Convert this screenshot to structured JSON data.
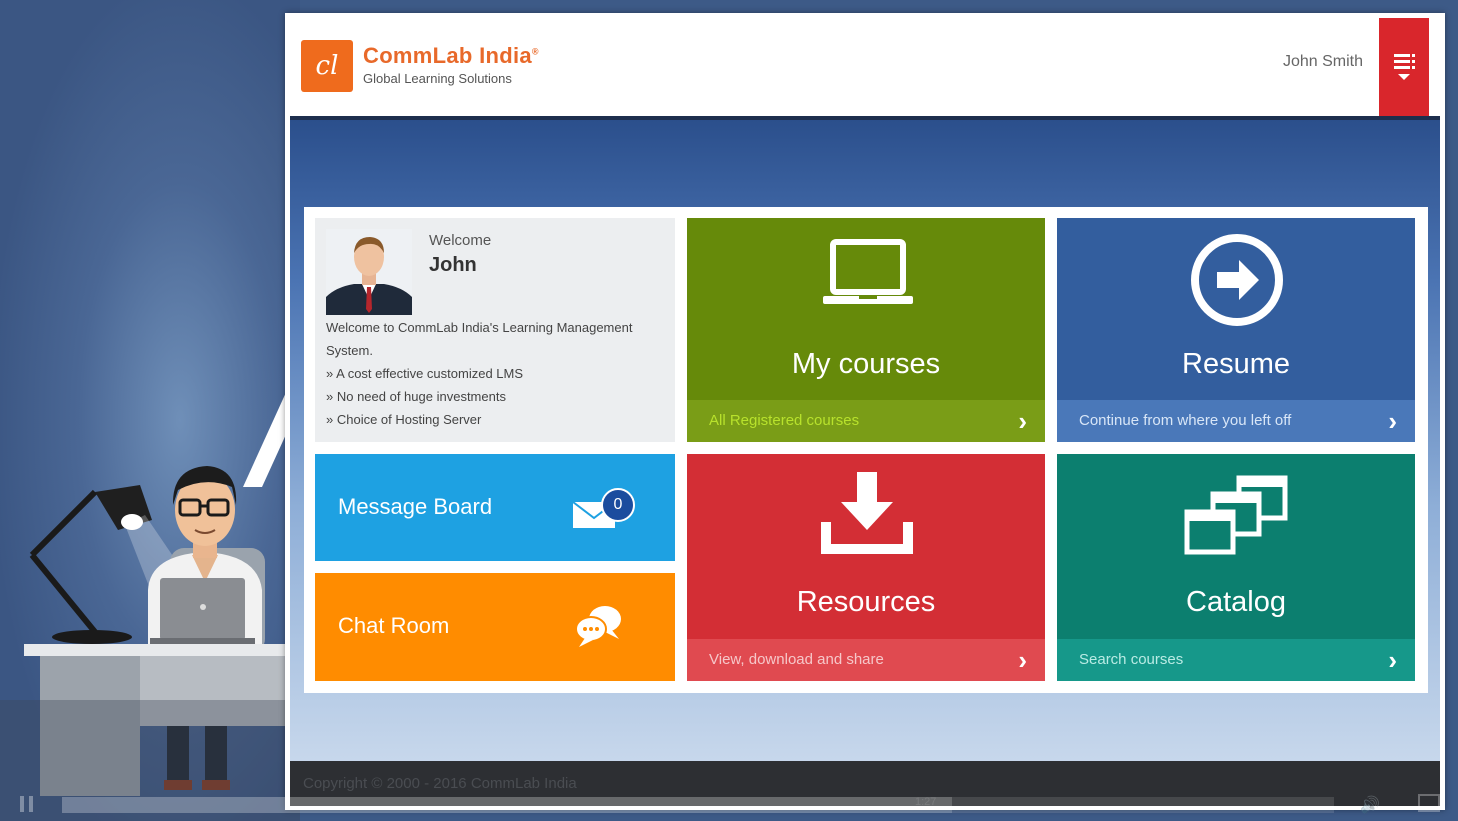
{
  "brand": {
    "name": "CommLab India",
    "registered": "®",
    "tagline": "Global Learning Solutions",
    "logo_letters": "cl"
  },
  "user": {
    "name": "John Smith"
  },
  "welcome": {
    "label": "Welcome",
    "name": "John",
    "intro": "Welcome to CommLab India's Learning Management System.",
    "bullets": [
      "A cost effective customized LMS",
      "No need of huge investments",
      "Choice of Hosting Server"
    ]
  },
  "tiles": {
    "mycourses": {
      "title": "My courses",
      "footer": "All Registered courses",
      "icon": "laptop-icon"
    },
    "resume": {
      "title": "Resume",
      "footer": "Continue from where you left off",
      "icon": "arrow-circle-icon"
    },
    "message_board": {
      "title": "Message Board",
      "count": "0",
      "icon": "envelope-icon"
    },
    "chat_room": {
      "title": "Chat Room",
      "icon": "chat-bubbles-icon"
    },
    "resources": {
      "title": "Resources",
      "footer": "View, download and share",
      "icon": "download-tray-icon"
    },
    "catalog": {
      "title": "Catalog",
      "footer": "Search courses",
      "icon": "windows-stack-icon"
    }
  },
  "footer": {
    "copyright": "Copyright © 2000 - 2016 CommLab India"
  },
  "video": {
    "progress": 0.7,
    "time": "1:27"
  },
  "colors": {
    "brand_orange": "#ef6b1d",
    "menu_red": "#d9262c",
    "mycourses_green": "#668a0a",
    "resume_blue": "#335e9e",
    "message_blue": "#1ea1e2",
    "chat_orange": "#ff8c00",
    "resources_red": "#d32e35",
    "catalog_teal": "#0c7f6f"
  }
}
